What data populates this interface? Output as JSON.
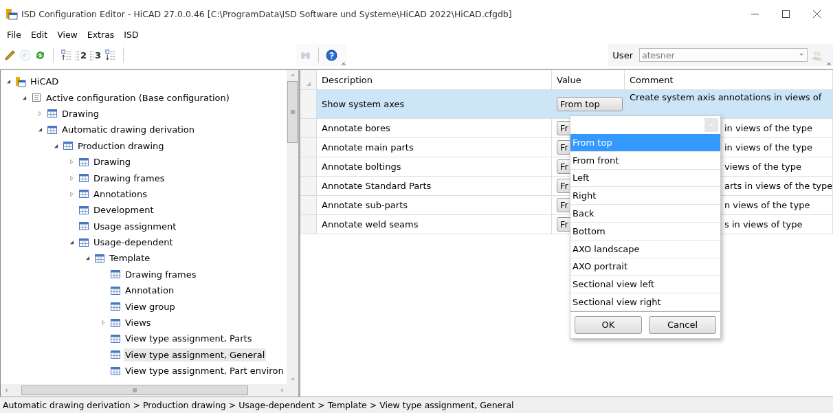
{
  "window": {
    "title": "ISD Configuration Editor  - HiCAD 27.0.0.46 [C:\\ProgramData\\ISD Software und Systeme\\HiCAD 2022\\HiCAD.cfgdb]"
  },
  "menu": [
    "File",
    "Edit",
    "View",
    "Extras",
    "ISD"
  ],
  "toolbar": [
    {
      "kind": "pencil",
      "disabled": false
    },
    {
      "kind": "undo",
      "disabled": true
    },
    {
      "kind": "refresh",
      "disabled": false
    },
    {
      "kind": "separator"
    },
    {
      "kind": "level-up",
      "disabled": false
    },
    {
      "kind": "level",
      "label": "2",
      "disabled": false
    },
    {
      "kind": "level",
      "label": "3",
      "disabled": false
    },
    {
      "kind": "level-down",
      "disabled": false
    },
    {
      "kind": "separator"
    }
  ],
  "toolbar2": [
    {
      "kind": "binoculars",
      "disabled": true
    },
    {
      "kind": "separator"
    },
    {
      "kind": "help",
      "disabled": false
    }
  ],
  "user": {
    "label": "User",
    "value": "atesner",
    "disabled": true
  },
  "tree": [
    {
      "label": "HiCAD",
      "kind": "root",
      "expanded": true,
      "selected": false,
      "children": [
        {
          "label": "Active configuration (Base configuration)",
          "kind": "config",
          "expanded": true,
          "selected": false,
          "children": [
            {
              "label": "Drawing",
              "kind": "table",
              "expanded": false,
              "selected": false
            },
            {
              "label": "Automatic drawing derivation",
              "kind": "table",
              "expanded": true,
              "selected": false,
              "children": [
                {
                  "label": "Production drawing",
                  "kind": "table",
                  "expanded": true,
                  "selected": false,
                  "children": [
                    {
                      "label": "Drawing",
                      "kind": "table",
                      "expanded": false,
                      "selected": false
                    },
                    {
                      "label": "Drawing frames",
                      "kind": "table",
                      "expanded": false,
                      "selected": false
                    },
                    {
                      "label": "Annotations",
                      "kind": "table",
                      "expanded": false,
                      "selected": false
                    },
                    {
                      "label": "Development",
                      "kind": "table",
                      "selected": false
                    },
                    {
                      "label": "Usage assignment",
                      "kind": "table",
                      "selected": false
                    },
                    {
                      "label": "Usage-dependent",
                      "kind": "table",
                      "expanded": true,
                      "selected": false,
                      "children": [
                        {
                          "label": "Template",
                          "kind": "table",
                          "expanded": true,
                          "selected": false,
                          "children": [
                            {
                              "label": "Drawing frames",
                              "kind": "table",
                              "selected": false
                            },
                            {
                              "label": "Annotation",
                              "kind": "table",
                              "selected": false
                            },
                            {
                              "label": "View group",
                              "kind": "table",
                              "selected": false
                            },
                            {
                              "label": "Views",
                              "kind": "table",
                              "expanded": false,
                              "selected": false
                            },
                            {
                              "label": "View type assignment, Parts",
                              "kind": "table",
                              "selected": false
                            },
                            {
                              "label": "View type assignment, General",
                              "kind": "table",
                              "selected": true
                            },
                            {
                              "label": "View type assignment, Part environ",
                              "kind": "table",
                              "selected": false
                            }
                          ]
                        }
                      ]
                    }
                  ]
                }
              ]
            }
          ]
        }
      ]
    }
  ],
  "table": {
    "columns": [
      "Description",
      "Value",
      "Comment"
    ],
    "rows": [
      {
        "description": "Show system axes",
        "value": "From top",
        "comment": "Create system axis annotations in views of",
        "selected": true
      },
      {
        "description": "Annotate bores",
        "value": "Fr",
        "comment": "in views of the type",
        "selected": false
      },
      {
        "description": "Annotate main parts",
        "value": "Fr",
        "comment": "in views of the type",
        "selected": false
      },
      {
        "description": "Annotate boltings",
        "value": "Fr",
        "comment": "views of the type",
        "selected": false
      },
      {
        "description": "Annotate Standard Parts",
        "value": "Fr",
        "comment": "arts in views of the type",
        "selected": false
      },
      {
        "description": "Annotate sub-parts",
        "value": "Fr",
        "comment": "n views of the type",
        "selected": false
      },
      {
        "description": "Annotate weld seams",
        "value": "Fr",
        "comment": "s in views of type",
        "selected": false
      }
    ]
  },
  "dropdown": {
    "options": [
      {
        "label": "From top",
        "selected": true
      },
      {
        "label": "From front",
        "selected": false
      },
      {
        "label": "Left",
        "selected": false
      },
      {
        "label": "Right",
        "selected": false
      },
      {
        "label": "Back",
        "selected": false
      },
      {
        "label": "Bottom",
        "selected": false
      },
      {
        "label": "AXO landscape",
        "selected": false
      },
      {
        "label": "AXO portrait",
        "selected": false
      },
      {
        "label": "Sectional view left",
        "selected": false
      },
      {
        "label": "Sectional view right",
        "selected": false
      }
    ],
    "buttons": [
      "OK",
      "Cancel"
    ]
  },
  "status_bar": "Automatic drawing derivation > Production drawing > Usage-dependent > Template > View type assignment, General"
}
